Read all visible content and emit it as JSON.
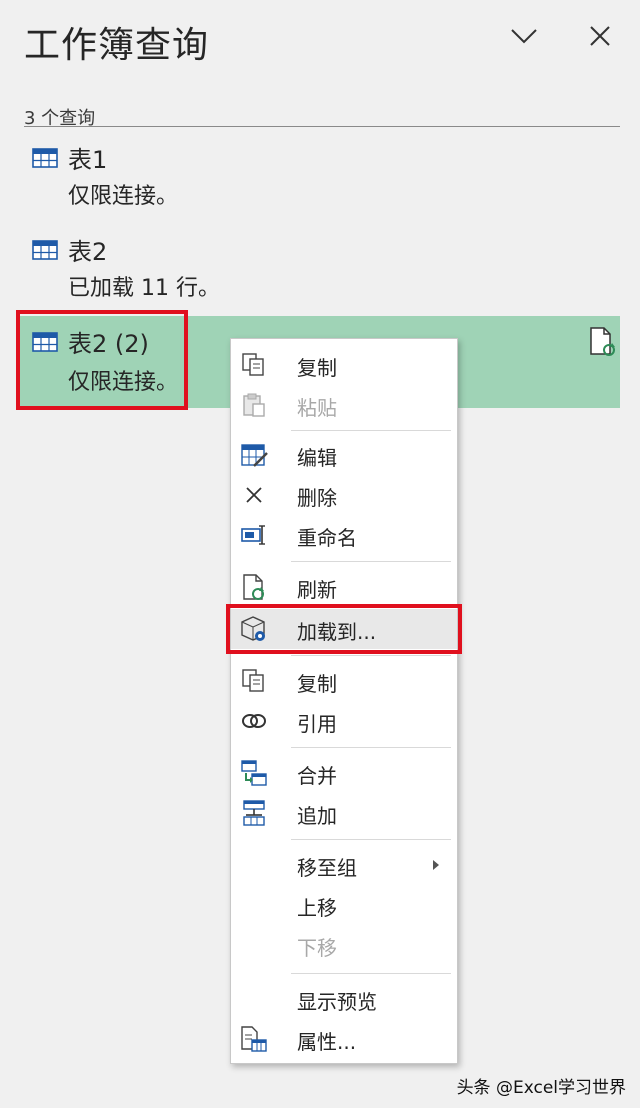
{
  "pane": {
    "title": "工作簿查询",
    "count_label": "3 个查询"
  },
  "queries": [
    {
      "name": "表1",
      "status": "仅限连接。"
    },
    {
      "name": "表2",
      "status": "已加载 11 行。"
    },
    {
      "name": "表2 (2)",
      "status": "仅限连接。",
      "selected": true
    }
  ],
  "context_menu": {
    "items": [
      {
        "label": "复制",
        "icon": "copy-icon",
        "enabled": true
      },
      {
        "label": "粘贴",
        "icon": "paste-icon",
        "enabled": false
      },
      {
        "label": "编辑",
        "icon": "edit-table-icon",
        "enabled": true
      },
      {
        "label": "删除",
        "icon": "delete-x-icon",
        "enabled": true
      },
      {
        "label": "重命名",
        "icon": "rename-icon",
        "enabled": true
      },
      {
        "label": "刷新",
        "icon": "refresh-icon",
        "enabled": true
      },
      {
        "label": "加载到...",
        "icon": "load-to-icon",
        "enabled": true,
        "highlighted": true
      },
      {
        "label": "复制",
        "icon": "duplicate-icon",
        "enabled": true
      },
      {
        "label": "引用",
        "icon": "reference-icon",
        "enabled": true
      },
      {
        "label": "合并",
        "icon": "merge-icon",
        "enabled": true
      },
      {
        "label": "追加",
        "icon": "append-icon",
        "enabled": true
      },
      {
        "label": "移至组",
        "icon": "",
        "enabled": true,
        "submenu": true
      },
      {
        "label": "上移",
        "icon": "",
        "enabled": true
      },
      {
        "label": "下移",
        "icon": "",
        "enabled": false
      },
      {
        "label": "显示预览",
        "icon": "",
        "enabled": true
      },
      {
        "label": "属性...",
        "icon": "properties-icon",
        "enabled": true
      }
    ]
  },
  "colors": {
    "selected_row": "#9fd3b6",
    "highlight_border": "#e0101e",
    "icon_blue": "#1e5aa8"
  },
  "watermark": "头条 @Excel学习世界"
}
